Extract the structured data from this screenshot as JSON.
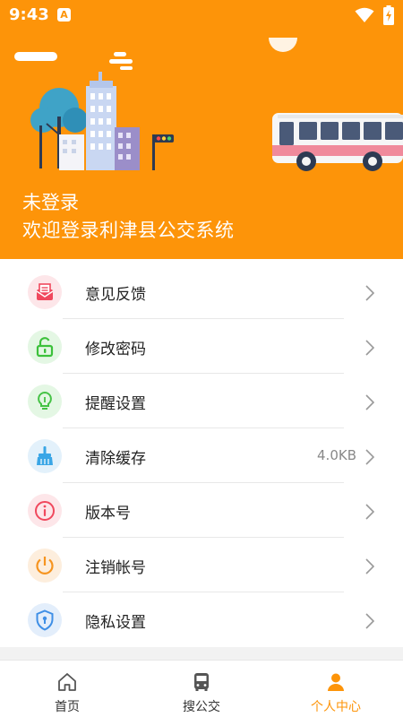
{
  "status_bar": {
    "time": "9:43",
    "notification_badge": "A"
  },
  "header": {
    "login_status": "未登录",
    "welcome_text": "欢迎登录利津县公交系统",
    "accent_color": "#fd9409"
  },
  "menu": {
    "items": [
      {
        "label": "意见反馈",
        "icon": "feedback-mail-icon",
        "color": "#f0485d"
      },
      {
        "label": "修改密码",
        "icon": "unlock-icon",
        "color": "#3cc13b"
      },
      {
        "label": "提醒设置",
        "icon": "lightbulb-icon",
        "color": "#45c245"
      },
      {
        "label": "清除缓存",
        "icon": "broom-icon",
        "color": "#3aa6e6",
        "value": "4.0KB"
      },
      {
        "label": "版本号",
        "icon": "info-icon",
        "color": "#f0485d"
      },
      {
        "label": "注销帐号",
        "icon": "power-icon",
        "color": "#f6941f"
      },
      {
        "label": "隐私设置",
        "icon": "shield-icon",
        "color": "#3f8fe6"
      }
    ]
  },
  "bottom_nav": {
    "tabs": [
      {
        "label": "首页",
        "icon": "home-icon",
        "active": false
      },
      {
        "label": "搜公交",
        "icon": "bus-icon",
        "active": false
      },
      {
        "label": "个人中心",
        "icon": "person-icon",
        "active": true
      }
    ]
  }
}
